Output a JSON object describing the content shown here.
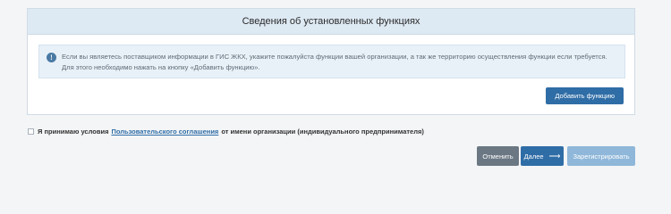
{
  "panel": {
    "title": "Сведения об установленных функциях",
    "info_icon": "info-icon",
    "info_text": "Если вы являетесь поставщиком информации в ГИС ЖКХ, укажите пожалуйста функции вашей организации, а так же территорию осуществления функции если требуется. Для этого необходимо нажать на кнопку «Добавить функцию».",
    "add_button": "Добавить функцию"
  },
  "agreement": {
    "prefix": "Я принимаю условия",
    "link": "Пользовательского соглашения",
    "suffix": "от имени организации (индивидуального предпринимателя)"
  },
  "actions": {
    "cancel": "Отменить",
    "next": "Далее",
    "next_icon": "arrow-right-icon",
    "register": "Зарегистрировать"
  },
  "colors": {
    "primary": "#2f6da6",
    "secondary": "#6b7884",
    "disabled": "#8fb7d9",
    "header_bg": "#dde9f3"
  }
}
